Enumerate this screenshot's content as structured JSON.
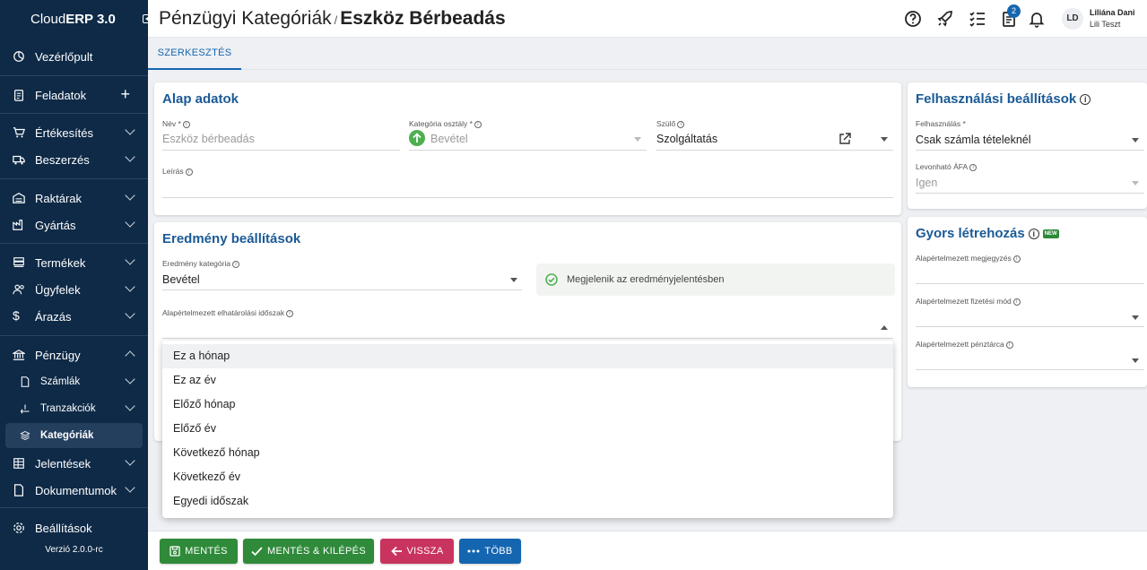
{
  "app": {
    "name_regular": "Cloud",
    "name_bold": "ERP 3.0",
    "version": "Verzió 2.0.0-rc"
  },
  "sidebar": {
    "items": [
      {
        "label": "Vezérlőpult"
      },
      {
        "label": "Feladatok"
      },
      {
        "label": "Értékesítés"
      },
      {
        "label": "Beszerzés"
      },
      {
        "label": "Raktárak"
      },
      {
        "label": "Gyártás"
      },
      {
        "label": "Termékek"
      },
      {
        "label": "Ügyfelek"
      },
      {
        "label": "Árazás"
      },
      {
        "label": "Pénzügy"
      },
      {
        "label": "Számlák"
      },
      {
        "label": "Tranzakciók"
      },
      {
        "label": "Kategóriák"
      },
      {
        "label": "Jelentések"
      },
      {
        "label": "Dokumentumok"
      },
      {
        "label": "Beállítások"
      }
    ]
  },
  "header": {
    "breadcrumb": "Pénzügyi Kategóriák",
    "separator": "/",
    "title": "Eszköz Bérbeadás",
    "task_badge": "2",
    "user_initials": "LD",
    "user_name": "Liliána Dani",
    "user_company": "Lili Teszt"
  },
  "tabs": [
    {
      "label": "SZERKESZTÉS"
    }
  ],
  "basic": {
    "title": "Alap adatok",
    "name_label": "Név *",
    "name_value": "Eszköz bérbeadás",
    "class_label": "Kategória osztály *",
    "class_value": "Bevétel",
    "parent_label": "Szülő",
    "parent_value": "Szolgáltatás",
    "desc_label": "Leírás"
  },
  "result": {
    "title": "Eredmény beállítások",
    "category_label": "Eredmény kategória",
    "category_value": "Bevétel",
    "report_note": "Megjelenik az eredményjelentésben",
    "period_label": "Alapértelmezett elhatárolási időszak"
  },
  "period_options": [
    "Ez a hónap",
    "Ez az év",
    "Előző hónap",
    "Előző év",
    "Következő hónap",
    "Következő év",
    "Egyedi időszak"
  ],
  "usage": {
    "title": "Felhasználási beállítások",
    "usage_label": "Felhasználás *",
    "usage_value": "Csak számla tételeknél",
    "vat_label": "Levonható ÁFA",
    "vat_value": "Igen"
  },
  "quick": {
    "title": "Gyors létrehozás",
    "new_badge": "NEW",
    "note_label": "Alapértelmezett megjegyzés",
    "payment_label": "Alapértelmezett fizetési mód",
    "wallet_label": "Alapértelmezett pénztárca"
  },
  "footer": {
    "save": "MENTÉS",
    "save_exit": "MENTÉS & KILÉPÉS",
    "back": "VISSZA",
    "more": "TÖBB"
  },
  "colors": {
    "sidebar": "#0e2a47",
    "accent": "#1566b0",
    "save": "#2f8a3a",
    "back": "#c9345e",
    "more": "#1566b0"
  }
}
